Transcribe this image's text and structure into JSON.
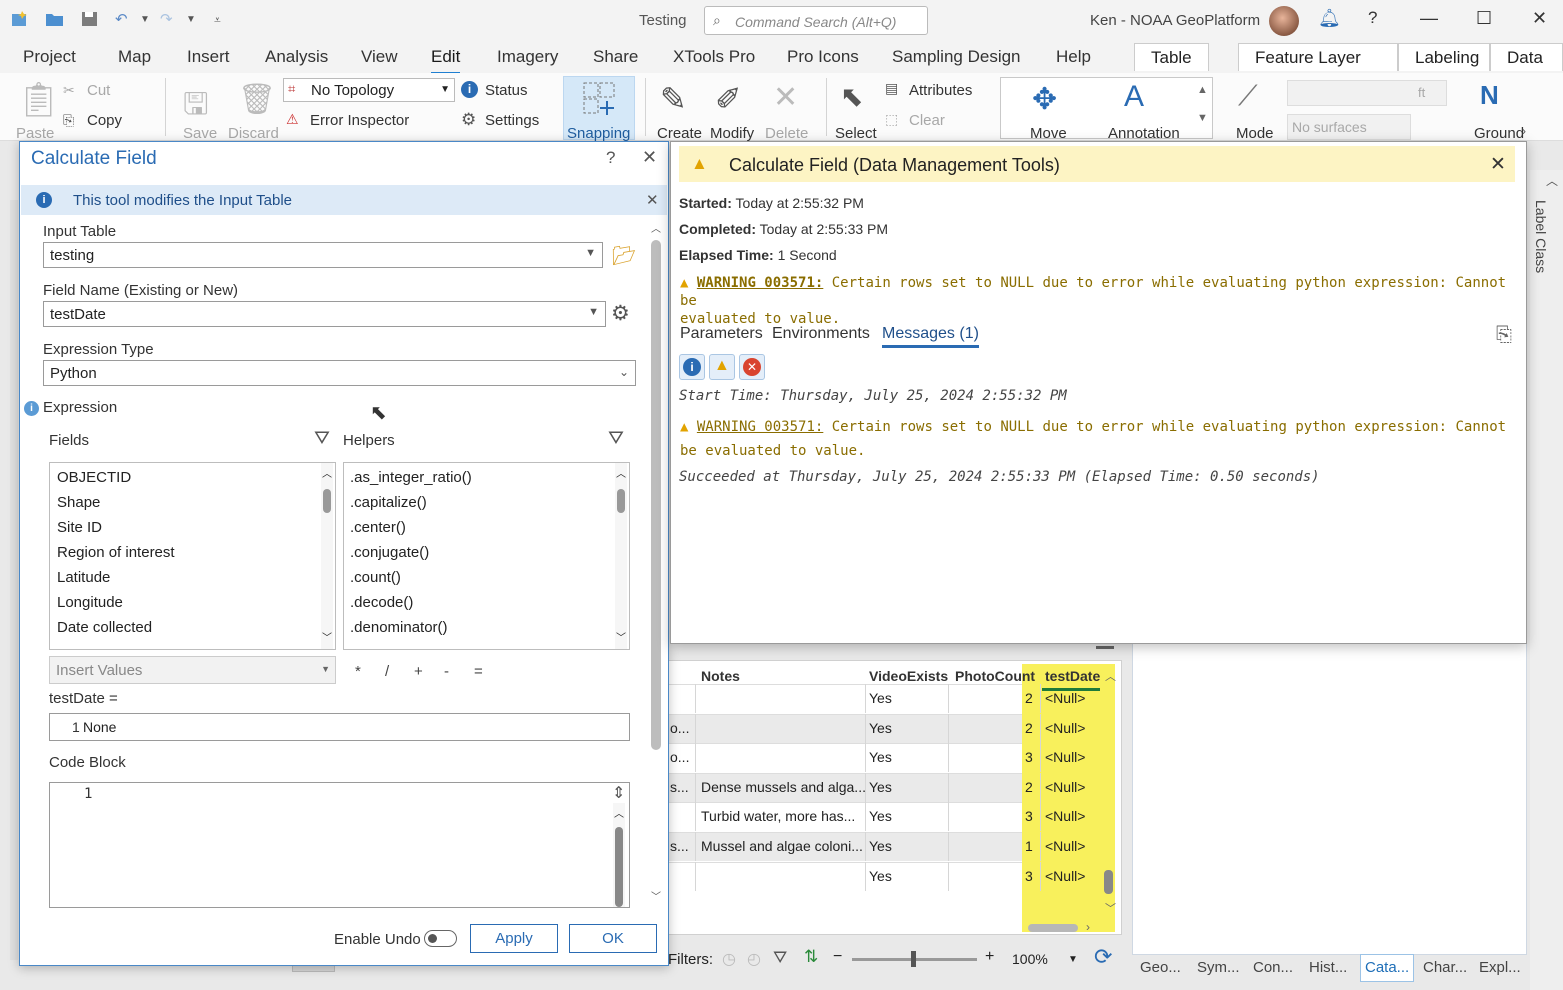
{
  "window": {
    "title": "Testing",
    "search_placeholder": "Command Search (Alt+Q)",
    "user": "Ken - NOAA GeoPlatform"
  },
  "ribbon_tabs": [
    "Project",
    "Map",
    "Insert",
    "Analysis",
    "View",
    "Edit",
    "Imagery",
    "Share",
    "XTools Pro",
    "Pro Icons",
    "Sampling Design",
    "Help"
  ],
  "active_tab": "Edit",
  "context_tabs": [
    "Table",
    "Feature Layer",
    "Labeling",
    "Data"
  ],
  "ribbon": {
    "paste": "Paste",
    "cut": "Cut",
    "copy": "Copy",
    "save": "Save",
    "discard": "Discard",
    "topology": "No Topology",
    "error_inspector": "Error Inspector",
    "status": "Status",
    "settings": "Settings",
    "snapping": "Snapping",
    "create": "Create",
    "modify": "Modify",
    "delete": "Delete",
    "select": "Select",
    "attributes": "Attributes",
    "clear": "Clear",
    "move": "Move",
    "annotation": "Annotation",
    "mode": "Mode",
    "unit": "ft",
    "surfaces": "No surfaces",
    "ground": "Ground"
  },
  "right_rail": {
    "label_class": "Label Class"
  },
  "bottom_tabs": [
    "Geo...",
    "Sym...",
    "Con...",
    "Hist...",
    "Cata...",
    "Char...",
    "Expl..."
  ],
  "bottom_tab_active": "Cata...",
  "table": {
    "headers": [
      "Notes",
      "VideoExists",
      "PhotoCount",
      "testDate"
    ],
    "rows": [
      {
        "frag": "",
        "notes": "",
        "video": "Yes",
        "photo": "",
        "num": "2",
        "date": "<Null>"
      },
      {
        "frag": "o...",
        "notes": "",
        "video": "Yes",
        "photo": "",
        "num": "2",
        "date": "<Null>"
      },
      {
        "frag": "o...",
        "notes": "",
        "video": "Yes",
        "photo": "",
        "num": "3",
        "date": "<Null>"
      },
      {
        "frag": "s...",
        "notes": "Dense mussels and alga...",
        "video": "Yes",
        "photo": "",
        "num": "2",
        "date": "<Null>"
      },
      {
        "frag": "",
        "notes": "Turbid water, more has...",
        "video": "Yes",
        "photo": "",
        "num": "3",
        "date": "<Null>"
      },
      {
        "frag": "s...",
        "notes": "Mussel and algae coloni...",
        "video": "Yes",
        "photo": "",
        "num": "1",
        "date": "<Null>"
      },
      {
        "frag": "",
        "notes": "",
        "video": "Yes",
        "photo": "",
        "num": "3",
        "date": "<Null>"
      }
    ]
  },
  "status_bar": {
    "filters": "Filters:",
    "zoom": "100%"
  },
  "dialog": {
    "title": "Calculate Field",
    "info": "This tool modifies the Input Table",
    "input_table_label": "Input Table",
    "input_table": "testing",
    "field_name_label": "Field Name (Existing or New)",
    "field_name": "testDate",
    "expr_type_label": "Expression Type",
    "expr_type": "Python",
    "expression_label": "Expression",
    "fields_label": "Fields",
    "helpers_label": "Helpers",
    "fields": [
      "OBJECTID",
      "Shape",
      "Site ID",
      "Region of interest",
      "Latitude",
      "Longitude",
      "Date collected"
    ],
    "helpers": [
      ".as_integer_ratio()",
      ".capitalize()",
      ".center()",
      ".conjugate()",
      ".count()",
      ".decode()",
      ".denominator()"
    ],
    "insert_values": "Insert Values",
    "operators": [
      "*",
      "/",
      "+",
      "-",
      "="
    ],
    "expr_target": "testDate =",
    "expr_line_no": "1",
    "expr_value": "None",
    "code_block_label": "Code Block",
    "code_line_no": "1",
    "enable_undo": "Enable Undo",
    "apply": "Apply",
    "ok": "OK"
  },
  "popup": {
    "title": "Calculate Field (Data Management Tools)",
    "started_label": "Started:",
    "started": "Today at 2:55:32 PM",
    "completed_label": "Completed:",
    "completed": "Today at 2:55:33 PM",
    "elapsed_label": "Elapsed Time:",
    "elapsed": "1 Second",
    "warn_code": "WARNING 003571:",
    "warn_text_1": "Certain rows set to NULL due to error while evaluating python expression: Cannot be",
    "warn_text_2": "evaluated to value.",
    "tabs": [
      "Parameters",
      "Environments",
      "Messages (1)"
    ],
    "msg_start": "Start Time: Thursday, July 25, 2024 2:55:32 PM",
    "msg_warn_1": "Certain rows set to NULL due to error while evaluating python expression: Cannot",
    "msg_warn_2": "be evaluated to value.",
    "msg_success": "Succeeded at Thursday, July 25, 2024 2:55:33 PM (Elapsed Time: 0.50 seconds)"
  }
}
